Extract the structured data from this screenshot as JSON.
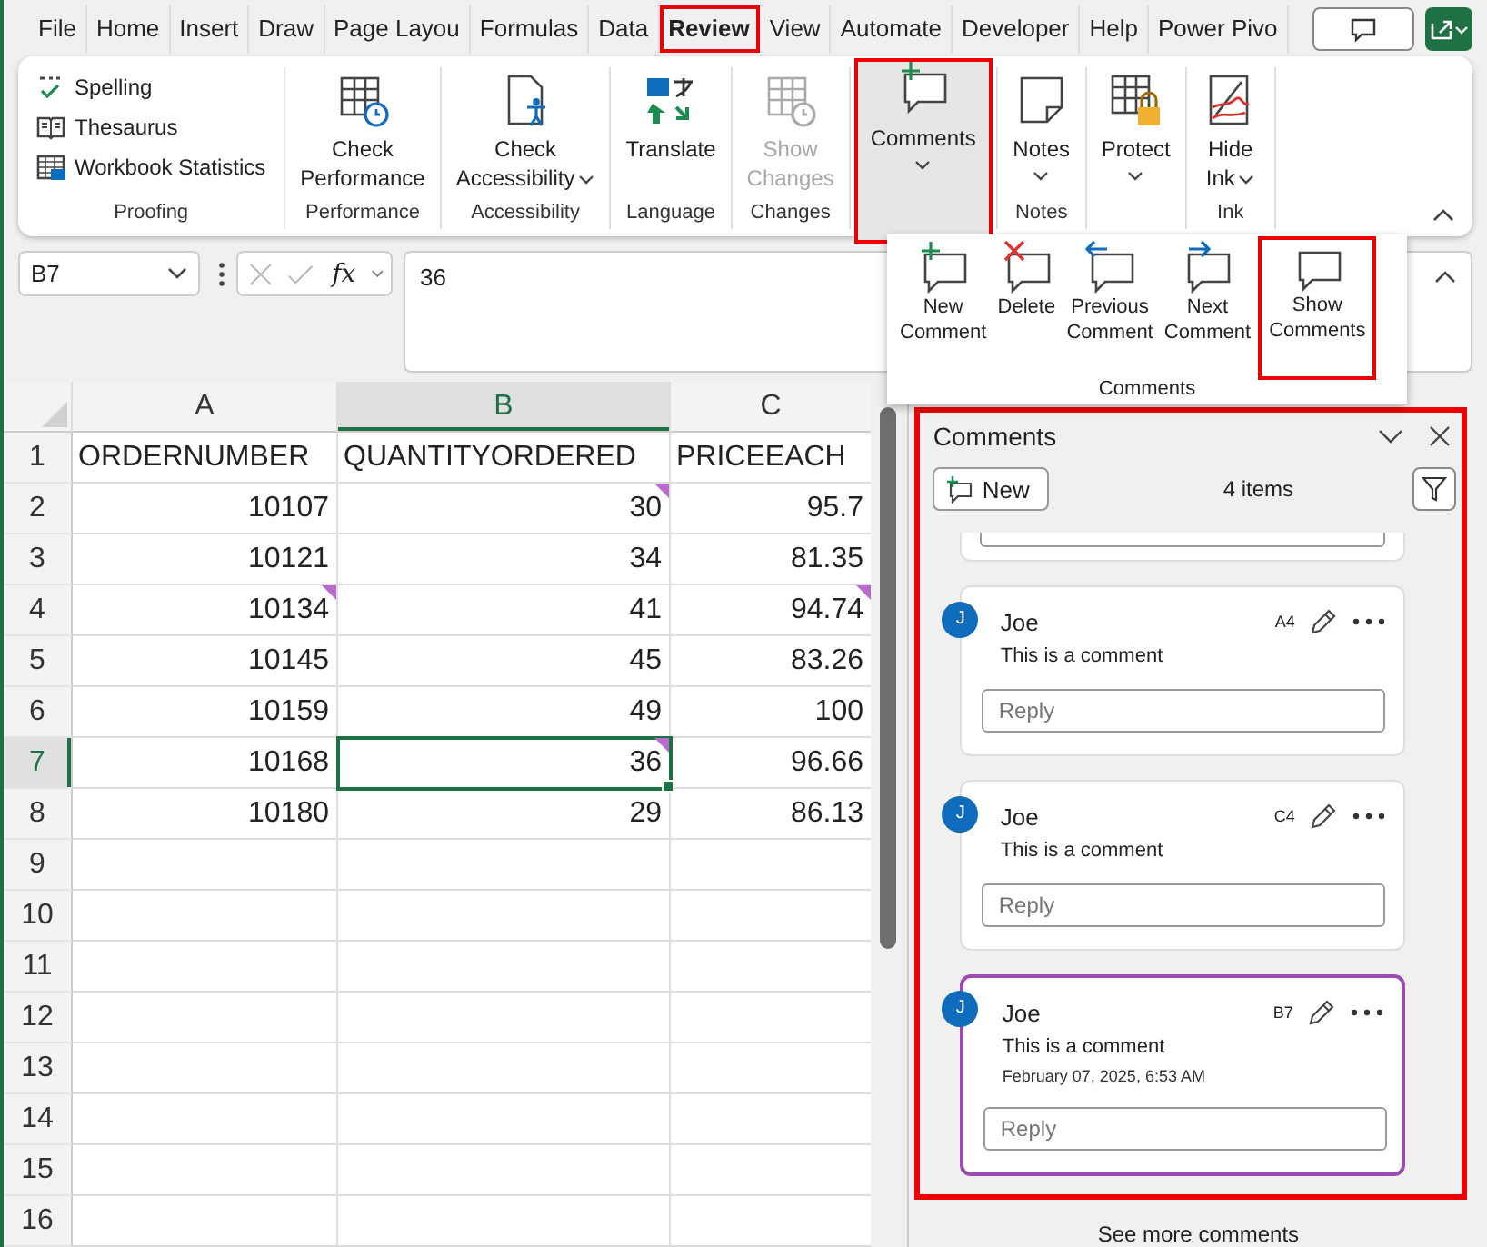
{
  "menu_tabs": [
    {
      "label": "File",
      "selected": false,
      "highlighted": false
    },
    {
      "label": "Home",
      "selected": false,
      "highlighted": false
    },
    {
      "label": "Insert",
      "selected": false,
      "highlighted": false
    },
    {
      "label": "Draw",
      "selected": false,
      "highlighted": false
    },
    {
      "label": "Page Layou",
      "selected": false,
      "highlighted": false
    },
    {
      "label": "Formulas",
      "selected": false,
      "highlighted": false
    },
    {
      "label": "Data",
      "selected": false,
      "highlighted": false
    },
    {
      "label": "Review",
      "selected": true,
      "highlighted": true
    },
    {
      "label": "View",
      "selected": false,
      "highlighted": false
    },
    {
      "label": "Automate",
      "selected": false,
      "highlighted": false
    },
    {
      "label": "Developer",
      "selected": false,
      "highlighted": false
    },
    {
      "label": "Help",
      "selected": false,
      "highlighted": false
    },
    {
      "label": "Power Pivo",
      "selected": false,
      "highlighted": false
    }
  ],
  "ribbon": {
    "groups": [
      {
        "label": "Proofing",
        "kind": "small",
        "buttons": [
          {
            "label": "Spelling"
          },
          {
            "label": "Thesaurus"
          },
          {
            "label": "Workbook Statistics"
          }
        ]
      },
      {
        "label": "Performance",
        "kind": "large",
        "buttons": [
          {
            "lines": [
              "Check",
              "Performance"
            ],
            "dropdown": false,
            "disabled": false,
            "expanded": false,
            "highlighted": false
          }
        ]
      },
      {
        "label": "Accessibility",
        "kind": "large",
        "buttons": [
          {
            "lines": [
              "Check",
              "Accessibility"
            ],
            "dropdown": true,
            "disabled": false,
            "expanded": false,
            "highlighted": false
          }
        ]
      },
      {
        "label": "Language",
        "kind": "large",
        "buttons": [
          {
            "lines": [
              "Translate"
            ],
            "dropdown": false,
            "disabled": false,
            "expanded": false,
            "highlighted": false
          }
        ]
      },
      {
        "label": "Changes",
        "kind": "large",
        "buttons": [
          {
            "lines": [
              "Show",
              "Changes"
            ],
            "dropdown": false,
            "disabled": true,
            "expanded": false,
            "highlighted": false
          }
        ]
      },
      {
        "kind": "large",
        "buttons": [
          {
            "lines": [
              "Comments"
            ],
            "dropdown": true,
            "disabled": false,
            "expanded": true,
            "highlighted": true
          }
        ]
      },
      {
        "label": "Notes",
        "kind": "large",
        "buttons": [
          {
            "lines": [
              "Notes"
            ],
            "dropdown": true,
            "disabled": false,
            "expanded": false,
            "highlighted": false
          }
        ]
      },
      {
        "kind": "large",
        "buttons": [
          {
            "lines": [
              "Protect"
            ],
            "dropdown": true,
            "disabled": false,
            "expanded": false,
            "highlighted": false
          }
        ]
      },
      {
        "label": "Ink",
        "kind": "large",
        "buttons": [
          {
            "lines": [
              "Hide",
              "Ink"
            ],
            "dropdown": true,
            "disabled": false,
            "expanded": false,
            "highlighted": false
          }
        ]
      }
    ]
  },
  "comments_menu": {
    "label": "Comments",
    "items": [
      {
        "lines": [
          "New",
          "Comment"
        ],
        "highlighted": false
      },
      {
        "lines": [
          "Delete"
        ],
        "highlighted": false
      },
      {
        "lines": [
          "Previous",
          "Comment"
        ],
        "highlighted": false
      },
      {
        "lines": [
          "Next",
          "Comment"
        ],
        "highlighted": false
      },
      {
        "lines": [
          "Show",
          "Comments"
        ],
        "highlighted": true
      }
    ]
  },
  "formula_bar": {
    "name_box": "B7",
    "function_button": "fx",
    "formula": "36"
  },
  "sheet": {
    "columns": [
      {
        "label": "A",
        "selected": false
      },
      {
        "label": "B",
        "selected": true
      },
      {
        "label": "C",
        "selected": false
      }
    ],
    "rows": [
      {
        "label": "1",
        "selected": false,
        "cells": [
          {
            "value": "ORDERNUMBER",
            "kind": "text",
            "has_comment": false,
            "selected": false
          },
          {
            "value": "QUANTITYORDERED",
            "kind": "text",
            "has_comment": false,
            "selected": false
          },
          {
            "value": "PRICEEACH",
            "kind": "text",
            "has_comment": false,
            "selected": false
          }
        ]
      },
      {
        "label": "2",
        "selected": false,
        "cells": [
          {
            "value": "10107",
            "kind": "number",
            "has_comment": false,
            "selected": false
          },
          {
            "value": "30",
            "kind": "number",
            "has_comment": true,
            "selected": false
          },
          {
            "value": "95.7",
            "kind": "number",
            "has_comment": false,
            "selected": false
          }
        ]
      },
      {
        "label": "3",
        "selected": false,
        "cells": [
          {
            "value": "10121",
            "kind": "number",
            "has_comment": false,
            "selected": false
          },
          {
            "value": "34",
            "kind": "number",
            "has_comment": false,
            "selected": false
          },
          {
            "value": "81.35",
            "kind": "number",
            "has_comment": false,
            "selected": false
          }
        ]
      },
      {
        "label": "4",
        "selected": false,
        "cells": [
          {
            "value": "10134",
            "kind": "number",
            "has_comment": true,
            "selected": false
          },
          {
            "value": "41",
            "kind": "number",
            "has_comment": false,
            "selected": false
          },
          {
            "value": "94.74",
            "kind": "number",
            "has_comment": true,
            "selected": false
          }
        ]
      },
      {
        "label": "5",
        "selected": false,
        "cells": [
          {
            "value": "10145",
            "kind": "number",
            "has_comment": false,
            "selected": false
          },
          {
            "value": "45",
            "kind": "number",
            "has_comment": false,
            "selected": false
          },
          {
            "value": "83.26",
            "kind": "number",
            "has_comment": false,
            "selected": false
          }
        ]
      },
      {
        "label": "6",
        "selected": false,
        "cells": [
          {
            "value": "10159",
            "kind": "number",
            "has_comment": false,
            "selected": false
          },
          {
            "value": "49",
            "kind": "number",
            "has_comment": false,
            "selected": false
          },
          {
            "value": "100",
            "kind": "number",
            "has_comment": false,
            "selected": false
          }
        ]
      },
      {
        "label": "7",
        "selected": true,
        "cells": [
          {
            "value": "10168",
            "kind": "number",
            "has_comment": false,
            "selected": false
          },
          {
            "value": "36",
            "kind": "number",
            "has_comment": true,
            "selected": true
          },
          {
            "value": "96.66",
            "kind": "number",
            "has_comment": false,
            "selected": false
          }
        ]
      },
      {
        "label": "8",
        "selected": false,
        "cells": [
          {
            "value": "10180",
            "kind": "number",
            "has_comment": false,
            "selected": false
          },
          {
            "value": "29",
            "kind": "number",
            "has_comment": false,
            "selected": false
          },
          {
            "value": "86.13",
            "kind": "number",
            "has_comment": false,
            "selected": false
          }
        ]
      },
      {
        "label": "9",
        "selected": false
      },
      {
        "label": "10",
        "selected": false
      },
      {
        "label": "11",
        "selected": false
      },
      {
        "label": "12",
        "selected": false
      },
      {
        "label": "13",
        "selected": false
      },
      {
        "label": "14",
        "selected": false
      },
      {
        "label": "15",
        "selected": false
      },
      {
        "label": "16",
        "selected": false
      }
    ]
  },
  "comments_pane": {
    "title": "Comments",
    "highlighted": true,
    "new_button": "New",
    "count": "4 items",
    "scrolled": true,
    "cards": [
      {
        "initial": "J",
        "author": "Joe",
        "cell": "A4",
        "text": "This is a comment",
        "reply_placeholder": "Reply",
        "selected": false
      },
      {
        "initial": "J",
        "author": "Joe",
        "cell": "C4",
        "text": "This is a comment",
        "reply_placeholder": "Reply",
        "selected": false
      },
      {
        "initial": "J",
        "author": "Joe",
        "cell": "B7",
        "text": "This is a comment",
        "date": "February 07, 2025, 6:53 AM",
        "reply_placeholder": "Reply",
        "selected": true
      }
    ],
    "footer": "See more comments"
  }
}
